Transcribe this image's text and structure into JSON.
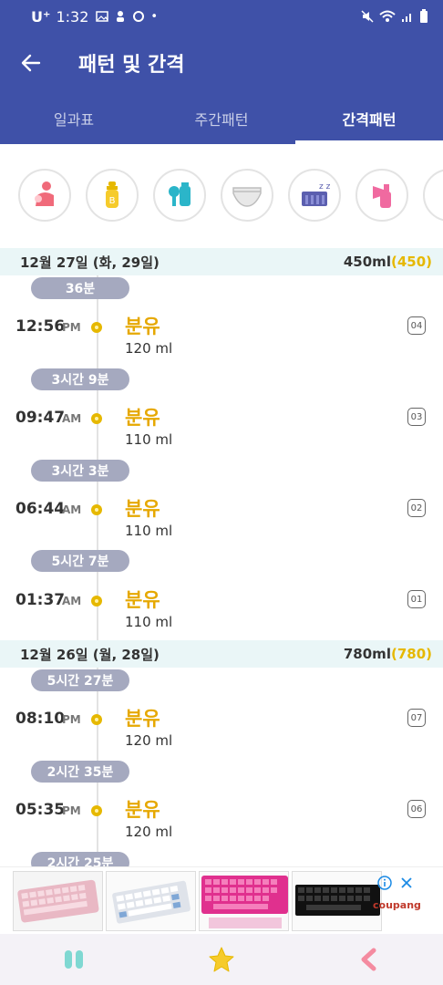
{
  "status_bar": {
    "carrier": "U⁺",
    "time": "1:32"
  },
  "app_bar": {
    "title": "패턴 및 간격",
    "back_icon": "arrow-back-icon"
  },
  "tabs": [
    {
      "label": "일과표",
      "active": false
    },
    {
      "label": "주간패턴",
      "active": false
    },
    {
      "label": "간격패턴",
      "active": true
    }
  ],
  "category_icons": [
    "breastfeeding-icon",
    "bottle-icon",
    "pump-bottle-icon",
    "diaper-icon",
    "sleep-crib-icon",
    "breast-pump-icon",
    "more-icon"
  ],
  "days": [
    {
      "header": "12월 27일 (화, 29일)",
      "total": "450ml",
      "total_accent": "(450)",
      "entries": [
        {
          "gap": "36분",
          "time": "12:56",
          "ampm": "PM",
          "name": "분유",
          "amount": "120 ml",
          "num": "04"
        },
        {
          "gap": "3시간 9분",
          "time": "09:47",
          "ampm": "AM",
          "name": "분유",
          "amount": "110 ml",
          "num": "03"
        },
        {
          "gap": "3시간 3분",
          "time": "06:44",
          "ampm": "AM",
          "name": "분유",
          "amount": "110 ml",
          "num": "02"
        },
        {
          "gap": "5시간 7분",
          "time": "01:37",
          "ampm": "AM",
          "name": "분유",
          "amount": "110 ml",
          "num": "01"
        }
      ]
    },
    {
      "header": "12월 26일 (월, 28일)",
      "total": "780ml",
      "total_accent": "(780)",
      "entries": [
        {
          "gap": "5시간 27분",
          "time": "08:10",
          "ampm": "PM",
          "name": "분유",
          "amount": "120 ml",
          "num": "07"
        },
        {
          "gap": "2시간 35분",
          "time": "05:35",
          "ampm": "PM",
          "name": "분유",
          "amount": "120 ml",
          "num": "06"
        },
        {
          "gap": "2시간 25분"
        }
      ]
    }
  ],
  "ad": {
    "brand": "coupang"
  },
  "bottom_nav": [
    "pause-icon",
    "star-icon",
    "chevron-left-icon"
  ],
  "colors": {
    "primary": "#3F51A8",
    "accent": "#E6B800",
    "gap_pill": "#A5A9BF",
    "day_header": "#EAF6F7"
  }
}
